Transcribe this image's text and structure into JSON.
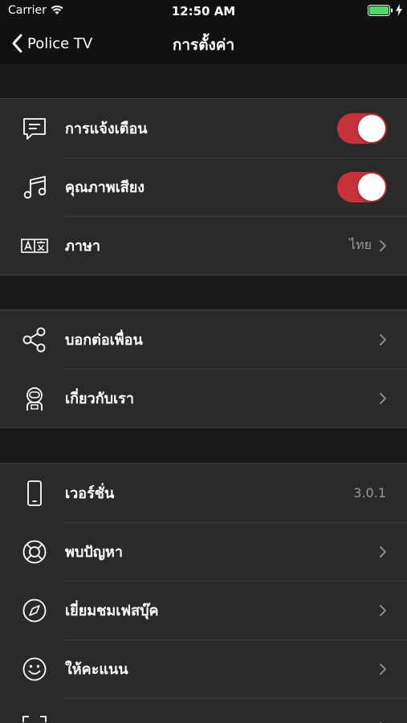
{
  "status_bar": {
    "carrier": "Carrier",
    "time": "12:50 AM",
    "battery_color": "#4cd964"
  },
  "nav": {
    "back_label": "Police TV",
    "title": "การตั้งค่า"
  },
  "groups": [
    {
      "items": [
        {
          "label": "การแจ้งเตือน",
          "icon": "message-icon",
          "control": "toggle",
          "on": true
        },
        {
          "label": "คุณภาพเสียง",
          "icon": "music-note-icon",
          "control": "toggle",
          "on": true
        },
        {
          "label": "ภาษา",
          "icon": "language-icon",
          "control": "value-chevron",
          "value": "ไทย"
        }
      ]
    },
    {
      "items": [
        {
          "label": "บอกต่อเพื่อน",
          "icon": "share-icon",
          "control": "chevron"
        },
        {
          "label": "เกี่ยวกับเรา",
          "icon": "astronaut-icon",
          "control": "chevron"
        }
      ]
    },
    {
      "items": [
        {
          "label": "เวอร์ชั่น",
          "icon": "phone-icon",
          "control": "value",
          "value": "3.0.1"
        },
        {
          "label": "พบปัญหา",
          "icon": "lifebuoy-icon",
          "control": "chevron"
        },
        {
          "label": "เยี่ยมชมเฟสบุ๊ค",
          "icon": "compass-icon",
          "control": "chevron"
        },
        {
          "label": "ให้คะแนน",
          "icon": "smiley-icon",
          "control": "chevron"
        }
      ]
    }
  ],
  "colors": {
    "toggle_on": "#c7313a",
    "group_bg": "#2a2a2a",
    "page_bg": "#181818",
    "value_text": "#9a9a9a"
  }
}
